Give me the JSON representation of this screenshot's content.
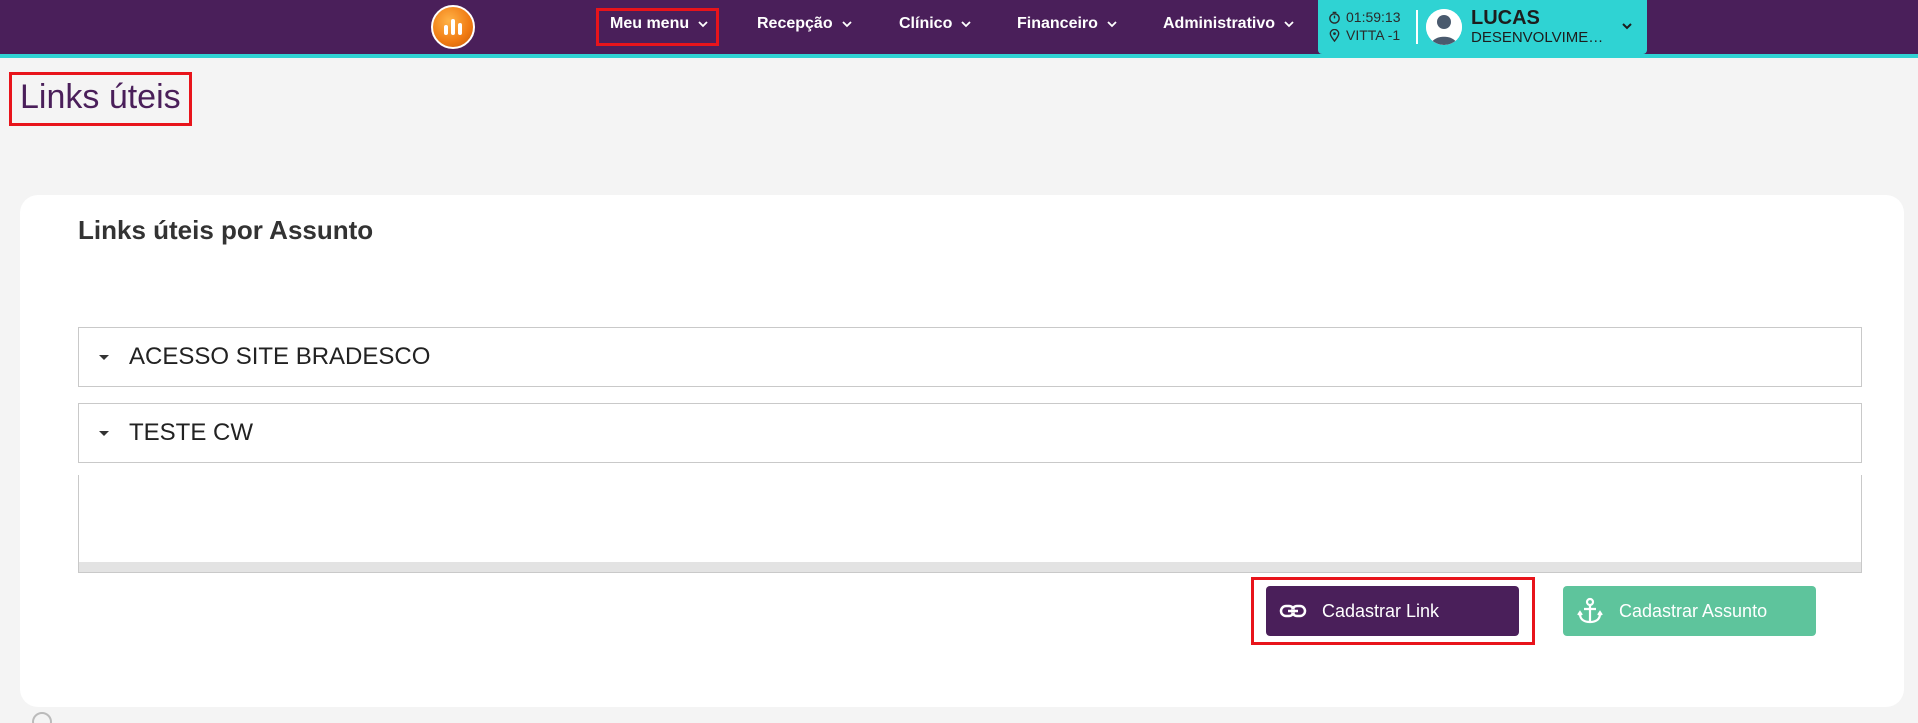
{
  "nav": {
    "items": [
      {
        "label": "Meu menu"
      },
      {
        "label": "Recepção"
      },
      {
        "label": "Clínico"
      },
      {
        "label": "Financeiro"
      },
      {
        "label": "Administrativo"
      }
    ]
  },
  "user": {
    "time": "01:59:13",
    "location": "VITTA -1",
    "name": "LUCAS",
    "role": "DESENVOLVIMEN..."
  },
  "page": {
    "title": "Links úteis"
  },
  "card": {
    "title": "Links úteis por Assunto",
    "accordions": [
      {
        "label": "ACESSO SITE BRADESCO"
      },
      {
        "label": "TESTE CW"
      }
    ],
    "buttons": {
      "cadastrar_link": "Cadastrar Link",
      "cadastrar_assunto": "Cadastrar Assunto"
    }
  },
  "colors": {
    "brand_purple": "#4a1f5a",
    "accent_teal": "#2fd3d3",
    "success_green": "#5ec49c",
    "highlight_red": "#e8141b"
  },
  "icons": {
    "logo": "brand-logo",
    "chevron": "chevron-down-icon",
    "clock": "stopwatch-icon",
    "pin": "location-pin-icon",
    "avatar": "user-avatar-icon",
    "link": "link-icon",
    "anchor": "anchor-icon",
    "caret": "caret-down-icon",
    "help": "help-icon"
  }
}
